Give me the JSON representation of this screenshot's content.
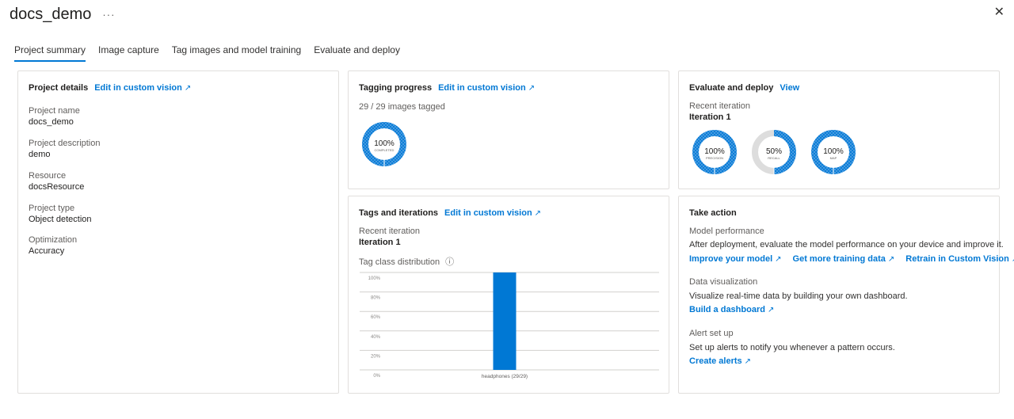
{
  "header": {
    "title": "docs_demo",
    "more": "···",
    "close": "✕"
  },
  "tabs": [
    {
      "label": "Project summary",
      "active": true
    },
    {
      "label": "Image capture"
    },
    {
      "label": "Tag images and model training"
    },
    {
      "label": "Evaluate and deploy"
    }
  ],
  "details": {
    "title": "Project details",
    "link": "Edit in custom vision",
    "fields": [
      {
        "label": "Project name",
        "value": "docs_demo"
      },
      {
        "label": "Project description",
        "value": "demo"
      },
      {
        "label": "Resource",
        "value": "docsResource"
      },
      {
        "label": "Project type",
        "value": "Object detection"
      },
      {
        "label": "Optimization",
        "value": "Accuracy"
      }
    ]
  },
  "tagging": {
    "title": "Tagging progress",
    "link": "Edit in custom vision",
    "count": "29 / 29 images tagged",
    "donut": {
      "percent": 100,
      "label": "100%",
      "caption": "COMPLETED"
    }
  },
  "evaluate": {
    "title": "Evaluate and deploy",
    "link": "View",
    "iteration_label": "Recent iteration",
    "iteration_value": "Iteration 1",
    "donuts": [
      {
        "percent": 100,
        "label": "100%",
        "caption": "PRECISION"
      },
      {
        "percent": 50,
        "label": "50%",
        "caption": "RECALL"
      },
      {
        "percent": 100,
        "label": "100%",
        "caption": "MAP"
      }
    ]
  },
  "tags": {
    "title": "Tags and iterations",
    "link": "Edit in custom vision",
    "iteration_label": "Recent iteration",
    "iteration_value": "Iteration 1",
    "dist_label": "Tag class distribution",
    "info": "ⓘ"
  },
  "chart_data": {
    "type": "bar",
    "categories": [
      "headphones (29/29)"
    ],
    "values": [
      100
    ],
    "ylim": [
      0,
      100
    ],
    "yticks": [
      "0%",
      "20%",
      "40%",
      "60%",
      "80%",
      "100%"
    ],
    "grid": true,
    "color": "#0078d4"
  },
  "action": {
    "title": "Take action",
    "perf_heading": "Model performance",
    "perf_text": "After deployment, evaluate the model performance on your device and improve it.",
    "perf_links": [
      "Improve your model",
      "Get more training data",
      "Retrain in Custom Vision"
    ],
    "viz_heading": "Data visualization",
    "viz_text": "Visualize real-time data by building your own dashboard.",
    "viz_link": "Build a dashboard",
    "alert_heading": "Alert set up",
    "alert_text": "Set up alerts to notify you whenever a pattern occurs.",
    "alert_link": "Create alerts"
  },
  "icons": {
    "external": "↗",
    "ext_icon_name": "external-link-icon"
  },
  "colors": {
    "accent": "#0078d4",
    "donut_bg": "#dddddd"
  }
}
